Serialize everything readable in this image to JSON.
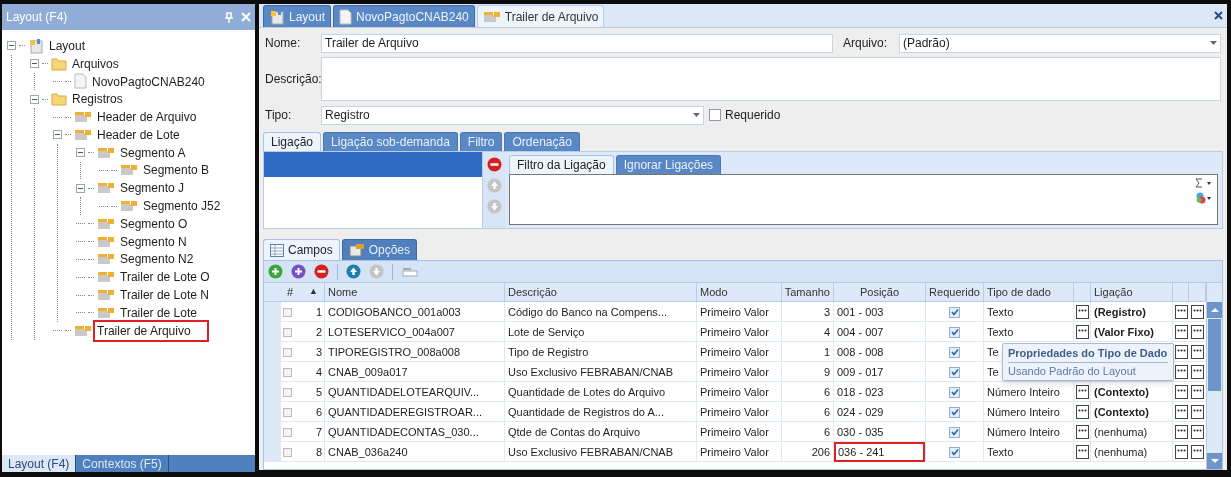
{
  "left_panel": {
    "title": "Layout (F4)",
    "tree": [
      {
        "label": "Layout",
        "kind": "root",
        "expanded": true,
        "highlighted": false,
        "children": [
          {
            "label": "Arquivos",
            "kind": "folder",
            "expanded": true,
            "highlighted": false,
            "children": [
              {
                "label": "NovoPagtoCNAB240",
                "kind": "file",
                "highlighted": false
              }
            ]
          },
          {
            "label": "Registros",
            "kind": "folder",
            "expanded": true,
            "highlighted": false,
            "children": [
              {
                "label": "Header de Arquivo",
                "kind": "record",
                "highlighted": false
              },
              {
                "label": "Header de Lote",
                "kind": "record",
                "expanded": true,
                "highlighted": false,
                "children": [
                  {
                    "label": "Segmento A",
                    "kind": "record",
                    "expanded": true,
                    "highlighted": false,
                    "children": [
                      {
                        "label": "Segmento B",
                        "kind": "record",
                        "highlighted": false
                      }
                    ]
                  },
                  {
                    "label": "Segmento J",
                    "kind": "record",
                    "expanded": true,
                    "highlighted": false,
                    "children": [
                      {
                        "label": "Segmento J52",
                        "kind": "record",
                        "highlighted": false
                      }
                    ]
                  },
                  {
                    "label": "Segmento O",
                    "kind": "record",
                    "highlighted": false
                  },
                  {
                    "label": "Segmento N",
                    "kind": "record",
                    "highlighted": false
                  },
                  {
                    "label": "Segmento N2",
                    "kind": "record",
                    "highlighted": false
                  },
                  {
                    "label": "Trailer de Lote O",
                    "kind": "record",
                    "highlighted": false
                  },
                  {
                    "label": "Trailer de Lote N",
                    "kind": "record",
                    "highlighted": false
                  },
                  {
                    "label": "Trailer de Lote",
                    "kind": "record",
                    "highlighted": false
                  }
                ]
              },
              {
                "label": "Trailer de Arquivo",
                "kind": "record",
                "highlighted": true
              }
            ]
          }
        ]
      }
    ],
    "bottom_tabs": [
      {
        "label": "Layout (F4)",
        "selected": true
      },
      {
        "label": "Contextos (F5)",
        "selected": false
      }
    ]
  },
  "doc_tabs": [
    {
      "label": "Layout",
      "kind": "root",
      "selected": false
    },
    {
      "label": "NovoPagtoCNAB240",
      "kind": "file",
      "selected": false
    },
    {
      "label": "Trailer de Arquivo",
      "kind": "record",
      "selected": true
    }
  ],
  "form": {
    "nome_label": "Nome:",
    "nome": "Trailer de Arquivo",
    "arquivo_label": "Arquivo:",
    "arquivo": "(Padrão)",
    "descricao_label": "Descrição:",
    "tipo_label": "Tipo:",
    "tipo": "Registro",
    "requerido_label": "Requerido",
    "requerido_checked": false
  },
  "ligacao_tabs": [
    {
      "label": "Ligação",
      "selected": true
    },
    {
      "label": "Ligação sob-demanda",
      "selected": false
    },
    {
      "label": "Filtro",
      "selected": false
    },
    {
      "label": "Ordenação",
      "selected": false
    }
  ],
  "ligacao_list": [
    {
      "selected": true
    }
  ],
  "filter_tabs": [
    {
      "label": "Filtro da Ligação",
      "selected": true
    },
    {
      "label": "Ignorar Ligações",
      "selected": false
    }
  ],
  "field_tabs": [
    {
      "label": "Campos",
      "kind": "grid",
      "selected": true
    },
    {
      "label": "Opções",
      "kind": "options",
      "selected": false
    }
  ],
  "grid": {
    "columns": [
      "#",
      "▲",
      "Nome",
      "Descrição",
      "Modo",
      "Tamanho",
      "Posição",
      "Requerido",
      "Tipo de dado",
      "Ligação"
    ],
    "rows": [
      {
        "num": "1",
        "nome": "CODIGOBANCO_001a003",
        "descricao": "Código do Banco na Compens...",
        "modo": "Primeiro Valor",
        "tamanho": "3",
        "posicao": "001 - 003",
        "requerido": true,
        "tipo": "Texto",
        "ligacao": "(Registro)",
        "ligacao_bold": true,
        "covered": false,
        "highlighted": false
      },
      {
        "num": "2",
        "nome": "LOTESERVICO_004a007",
        "descricao": "Lote de Serviço",
        "modo": "Primeiro Valor",
        "tamanho": "4",
        "posicao": "004 - 007",
        "requerido": true,
        "tipo": "Texto",
        "ligacao": "(Valor Fixo)",
        "ligacao_bold": true,
        "covered": false,
        "highlighted": false
      },
      {
        "num": "3",
        "nome": "TIPOREGISTRO_008a008",
        "descricao": "Tipo de Registro",
        "modo": "Primeiro Valor",
        "tamanho": "1",
        "posicao": "008 - 008",
        "requerido": true,
        "tipo": "Te",
        "covered": true,
        "highlighted": false
      },
      {
        "num": "4",
        "nome": "CNAB_009a017",
        "descricao": "Uso Exclusivo FEBRABAN/CNAB",
        "modo": "Primeiro Valor",
        "tamanho": "9",
        "posicao": "009 - 017",
        "requerido": true,
        "tipo": "Te",
        "covered": true,
        "highlighted": false
      },
      {
        "num": "5",
        "nome": "QUANTIDADELOTEARQUIV...",
        "descricao": "Quantidade de Lotes do Arquivo",
        "modo": "Primeiro Valor",
        "tamanho": "6",
        "posicao": "018 - 023",
        "requerido": true,
        "tipo": "Número Inteiro",
        "ligacao": "(Contexto)",
        "ligacao_bold": true,
        "covered": false,
        "highlighted": false
      },
      {
        "num": "6",
        "nome": "QUANTIDADEREGISTROAR...",
        "descricao": "Quantidade de Registros do A...",
        "modo": "Primeiro Valor",
        "tamanho": "6",
        "posicao": "024 - 029",
        "requerido": true,
        "tipo": "Número Inteiro",
        "ligacao": "(Contexto)",
        "ligacao_bold": true,
        "covered": false,
        "highlighted": false
      },
      {
        "num": "7",
        "nome": "QUANTIDADECONTAS_030...",
        "descricao": "Qtde de Contas do Arquivo",
        "modo": "Primeiro Valor",
        "tamanho": "6",
        "posicao": "030 - 035",
        "requerido": true,
        "tipo": "Número Inteiro",
        "ligacao": "(nenhuma)",
        "ligacao_bold": false,
        "covered": false,
        "highlighted": false
      },
      {
        "num": "8",
        "nome": "CNAB_036a240",
        "descricao": "Uso Exclusivo FEBRABAN/CNAB",
        "modo": "Primeiro Valor",
        "tamanho": "206",
        "posicao": "036 - 241",
        "requerido": true,
        "tipo": "Texto",
        "ligacao": "(nenhuma)",
        "ligacao_bold": false,
        "covered": false,
        "highlighted": true
      }
    ]
  },
  "tooltip": {
    "title": "Propriedades do Tipo de Dado",
    "text": "Usando Padrão do Layout"
  }
}
